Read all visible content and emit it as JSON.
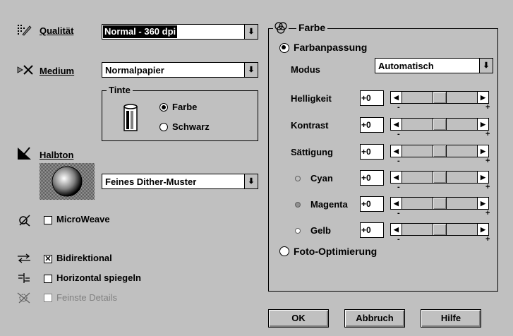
{
  "qualitaet": {
    "label": "Qualität",
    "value": "Normal - 360 dpi"
  },
  "medium": {
    "label": "Medium",
    "value": "Normalpapier"
  },
  "tinte": {
    "title": "Tinte",
    "option_farbe": "Farbe",
    "option_schwarz": "Schwarz",
    "selected": "Farbe"
  },
  "halbton": {
    "label": "Halbton",
    "value": "Feines Dither-Muster"
  },
  "microweave": {
    "label": "MicroWeave",
    "checked": false
  },
  "bidirektional": {
    "label": "Bidirektional",
    "checked": true
  },
  "horizontal_spiegeln": {
    "label": "Horizontal spiegeln",
    "checked": false
  },
  "feinste_details": {
    "label": "Feinste Details",
    "checked": false,
    "disabled": true
  },
  "farbe": {
    "title": "Farbe",
    "farbanpassung_label": "Farbanpassung",
    "farbanpassung_selected": true,
    "modus_label": "Modus",
    "modus_value": "Automatisch",
    "sliders": [
      {
        "label": "Helligkeit",
        "value": "+0",
        "position": 0.5
      },
      {
        "label": "Kontrast",
        "value": "+0",
        "position": 0.5
      },
      {
        "label": "Sättigung",
        "value": "+0",
        "position": 0.5
      },
      {
        "label": "Cyan",
        "value": "+0",
        "position": 0.5,
        "dot_color": "#c0c0c0"
      },
      {
        "label": "Magenta",
        "value": "+0",
        "position": 0.5,
        "dot_color": "#909090"
      },
      {
        "label": "Gelb",
        "value": "+0",
        "position": 0.5,
        "dot_color": "#ffffff"
      }
    ],
    "slider_minus": "-",
    "slider_plus": "+",
    "foto_label": "Foto-Optimierung",
    "foto_selected": false
  },
  "buttons": {
    "ok": "OK",
    "abbruch": "Abbruch",
    "hilfe": "Hilfe"
  },
  "dropdown_arrow": "⬇",
  "left_arrow": "◀",
  "right_arrow": "▶"
}
